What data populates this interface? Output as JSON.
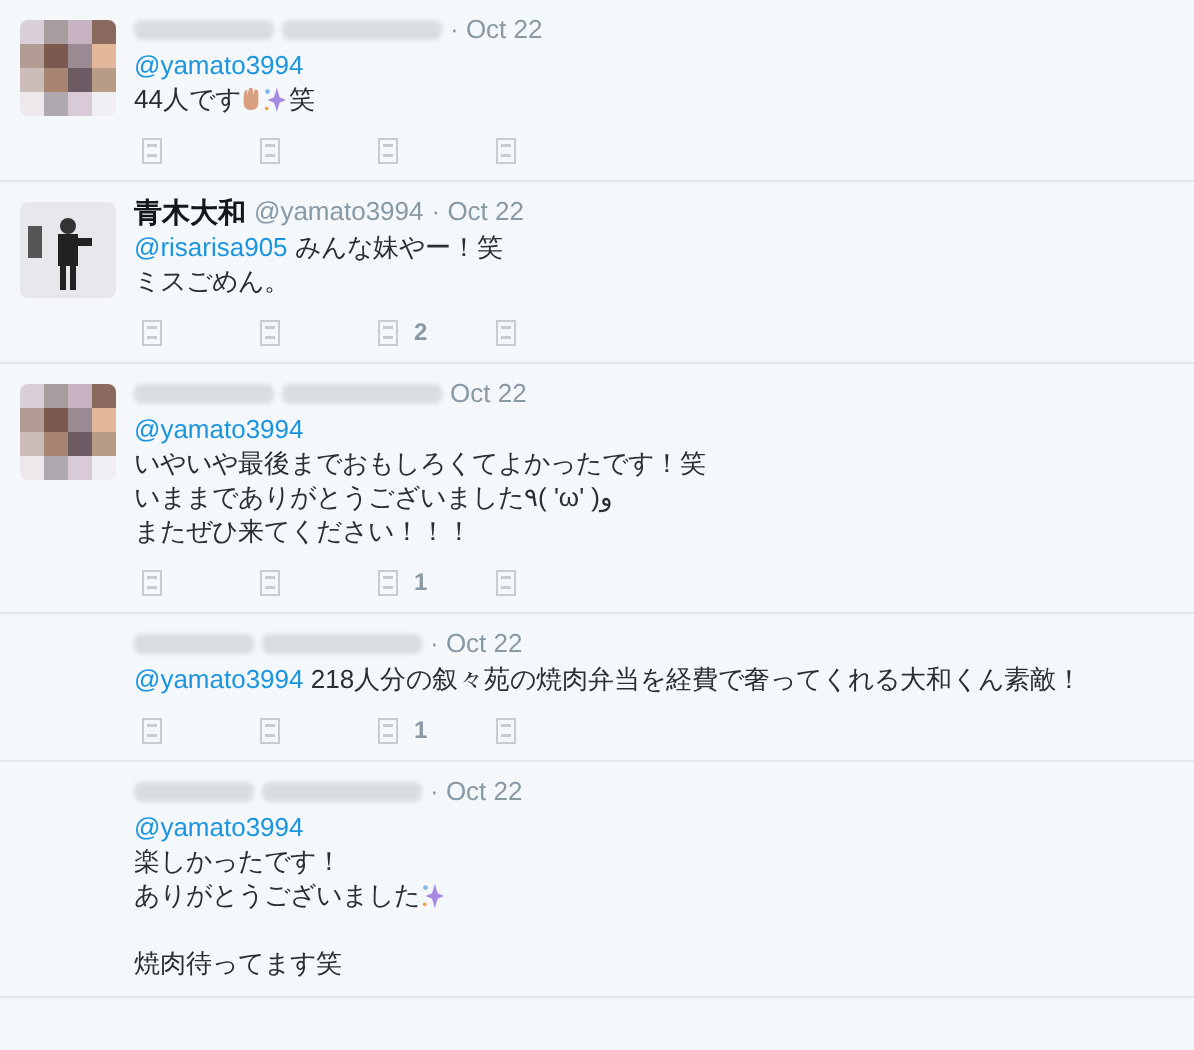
{
  "tweets": [
    {
      "avatar": {
        "kind": "mosaic"
      },
      "date": "· Oct 22",
      "lines": [
        {
          "segs": [
            {
              "kind": "mention",
              "text": "@yamato3994"
            }
          ]
        },
        {
          "segs": [
            {
              "kind": "text",
              "text": "44人です"
            },
            {
              "kind": "hand"
            },
            {
              "kind": "sparkles"
            },
            {
              "kind": "text",
              "text": "笑"
            }
          ]
        }
      ],
      "action_bar": true
    },
    {
      "name": "青木大和",
      "handle": "@yamato3994",
      "date": "· Oct 22",
      "lines": [
        {
          "segs": [
            {
              "kind": "mention",
              "text": "@risarisa905"
            },
            {
              "kind": "text",
              "text": " みんな妹やー！笑"
            }
          ]
        },
        {
          "segs": [
            {
              "kind": "text",
              "text": "ミスごめん。"
            }
          ]
        }
      ],
      "action_bar": true,
      "like_count": "2"
    },
    {
      "avatar": {
        "kind": "mosaic"
      },
      "date": "Oct 22",
      "lines": [
        {
          "segs": [
            {
              "kind": "mention",
              "text": "@yamato3994"
            }
          ]
        },
        {
          "segs": [
            {
              "kind": "text",
              "text": "いやいや最後までおもしろくてよかったです！笑"
            }
          ]
        },
        {
          "segs": [
            {
              "kind": "text",
              "text": "いままでありがとうございました٩( 'ω' )و"
            }
          ]
        },
        {
          "segs": [
            {
              "kind": "text",
              "text": "またぜひ来てください！！！"
            }
          ]
        }
      ],
      "action_bar": true,
      "like_count": "1"
    },
    {
      "date": "· Oct 22",
      "lines": [
        {
          "segs": [
            {
              "kind": "mention",
              "text": "@yamato3994"
            },
            {
              "kind": "text",
              "text": " 218人分の叙々苑の焼肉弁当を経費で奢ってくれる大和くん素敵！"
            }
          ]
        }
      ],
      "action_bar": true,
      "like_count": "1"
    },
    {
      "date": "· Oct 22",
      "lines": [
        {
          "segs": [
            {
              "kind": "mention",
              "text": "@yamato3994"
            }
          ]
        },
        {
          "segs": [
            {
              "kind": "text",
              "text": "楽しかったです！"
            }
          ]
        },
        {
          "segs": [
            {
              "kind": "text",
              "text": "ありがとうございました"
            },
            {
              "kind": "sparkles"
            }
          ]
        },
        {
          "space_before": true,
          "segs": [
            {
              "kind": "text",
              "text": "焼肉待ってます笑"
            }
          ]
        }
      ]
    }
  ]
}
